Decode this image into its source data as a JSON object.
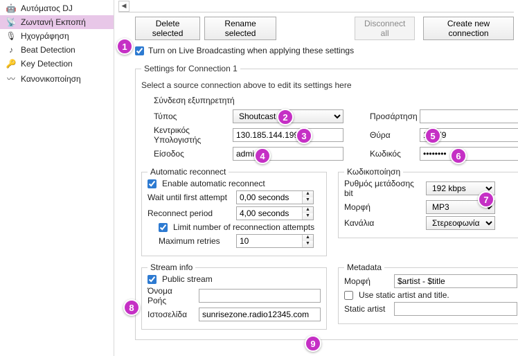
{
  "sidebar": {
    "items": [
      {
        "label": "Αυτόματος DJ",
        "active": false
      },
      {
        "label": "Ζωντανή Εκποπή",
        "active": true
      },
      {
        "label": "Ηχογράφηση",
        "active": false
      },
      {
        "label": "Beat Detection",
        "active": false
      },
      {
        "label": "Key Detection",
        "active": false
      },
      {
        "label": "Κανονικοποίηση",
        "active": false
      }
    ]
  },
  "toolbar": {
    "delete_label": "Delete selected",
    "rename_label": "Rename selected",
    "disconnect_label": "Disconnect all",
    "create_label": "Create new connection"
  },
  "live": {
    "enable_label": "Turn on Live Broadcasting when applying these settings"
  },
  "settings_legend": "Settings for Connection 1",
  "settings_help": "Select a source connection above to edit its settings here",
  "section_server": "Σύνδεση εξυπηρετητή",
  "server": {
    "type_label": "Τύπος",
    "type_value": "Shoutcast 1",
    "host_label": "Κεντρικός Υπολογιστής",
    "host_value": "130.185.144.199",
    "login_label": "Είσοδος",
    "login_value": "admin",
    "mount_label": "Προσάρτηση",
    "mount_value": "",
    "port_label": "Θύρα",
    "port_value": "10579",
    "password_label": "Κωδικός",
    "password_value": "••••••••"
  },
  "reconnect": {
    "legend": "Automatic reconnect",
    "enable_label": "Enable automatic reconnect",
    "wait_label": "Wait until first attempt",
    "wait_value": "0,00 seconds",
    "period_label": "Reconnect period",
    "period_value": "4,00 seconds",
    "limit_label": "Limit number of reconnection attempts",
    "max_label": "Maximum retries",
    "max_value": "10"
  },
  "encoding": {
    "legend": "Κωδικοποίηση",
    "bitrate_label": "Ρυθμός μετάδοσης bit",
    "bitrate_value": "192 kbps",
    "format_label": "Μορφή",
    "format_value": "MP3",
    "channels_label": "Κανάλια",
    "channels_value": "Στερεοφωνία"
  },
  "stream": {
    "legend": "Stream info",
    "public_label": "Public stream",
    "name_label": "Όνομα Ροής",
    "name_value": "",
    "website_label": "Ιστοσελίδα",
    "website_value": "sunrisezone.radio12345.com"
  },
  "metadata": {
    "legend": "Metadata",
    "format_label": "Μορφή",
    "format_value": "$artist - $title",
    "static_label": "Use static artist and title.",
    "artist_label": "Static artist",
    "artist_value": ""
  },
  "callouts": {
    "c1": "1",
    "c2": "2",
    "c3": "3",
    "c4": "4",
    "c5": "5",
    "c6": "6",
    "c7": "7",
    "c8": "8",
    "c9": "9"
  }
}
